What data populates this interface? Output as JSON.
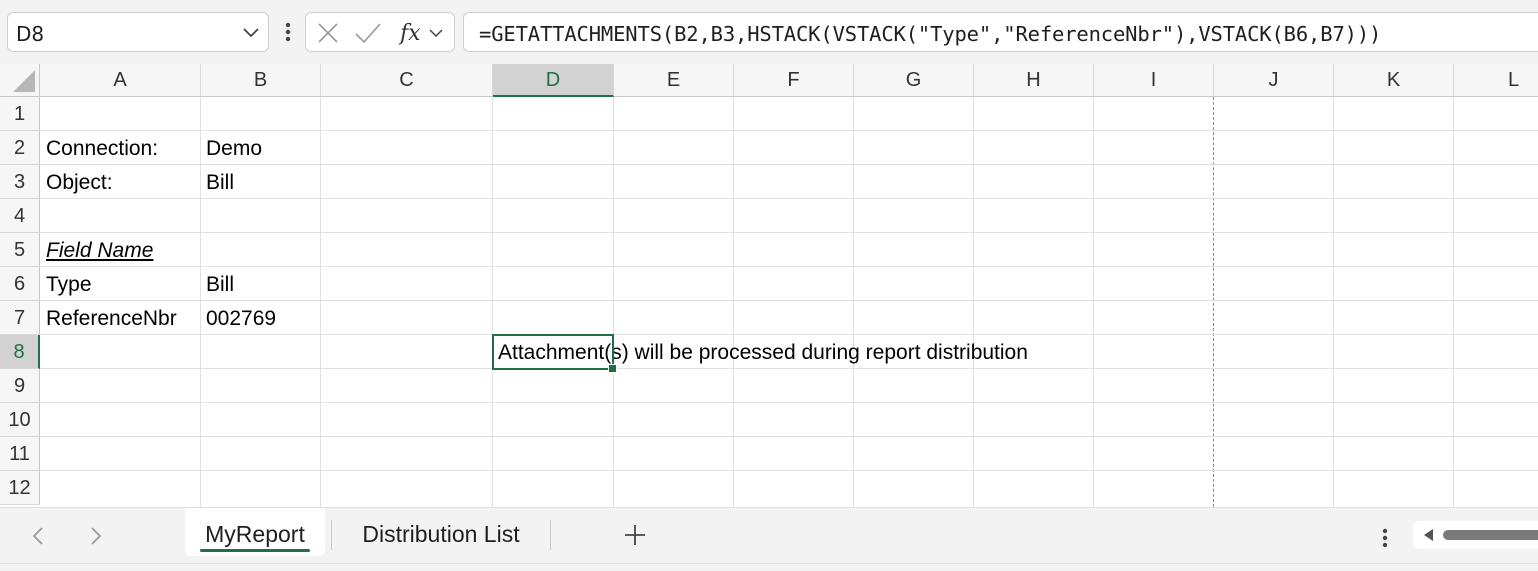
{
  "formula_bar": {
    "name_box": "D8",
    "formula": "=GETATTACHMENTS(B2,B3,HSTACK(VSTACK(\"Type\",\"ReferenceNbr\"),VSTACK(B6,B7)))"
  },
  "columns": [
    "A",
    "B",
    "C",
    "D",
    "E",
    "F",
    "G",
    "H",
    "I",
    "J",
    "K",
    "L"
  ],
  "rows": [
    "1",
    "2",
    "3",
    "4",
    "5",
    "6",
    "7",
    "8",
    "9",
    "10",
    "11",
    "12"
  ],
  "selected_cell": "D8",
  "cells": {
    "A2": "Connection:",
    "B2": "Demo",
    "A3": "Object:",
    "B3": "Bill",
    "A5": "Field Name",
    "A6": "Type",
    "B6": "Bill",
    "A7": "ReferenceNbr",
    "B7": "002769",
    "D8": "Attachment(s) will be processed during report distribution"
  },
  "sheet_tabs": [
    {
      "label": "MyReport",
      "active": true
    },
    {
      "label": "Distribution List",
      "active": false
    }
  ],
  "colors": {
    "accent": "#1e7145",
    "header_bg": "#f6f6f6",
    "gridline": "#e1e1e1"
  }
}
